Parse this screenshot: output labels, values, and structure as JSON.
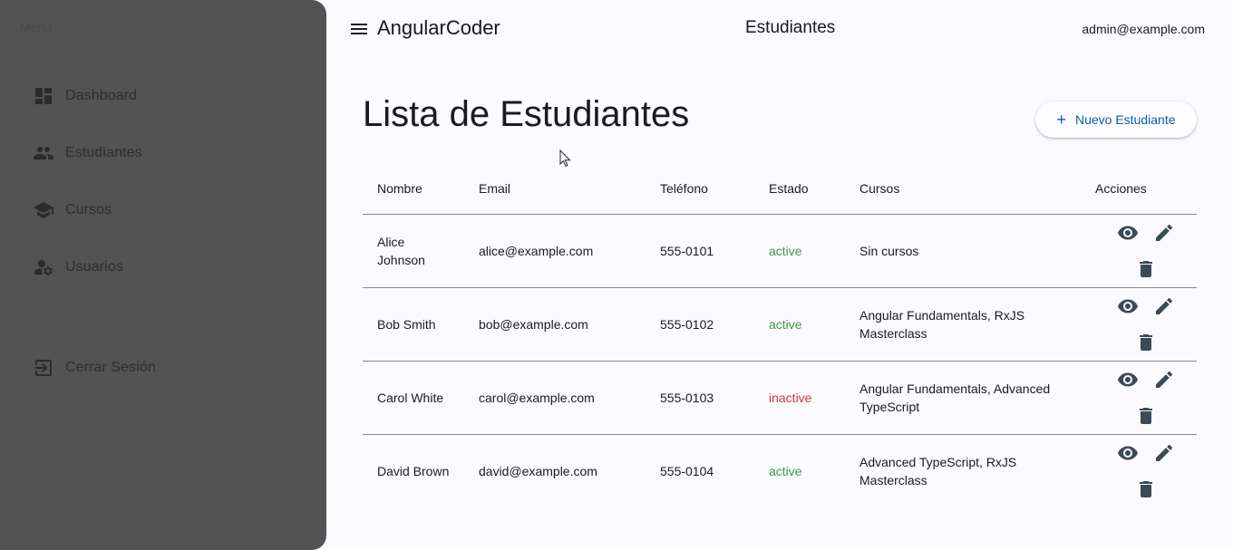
{
  "sidebar": {
    "logo": "Menu",
    "items": [
      {
        "label": "Dashboard",
        "icon": "dashboard-icon"
      },
      {
        "label": "Estudiantes",
        "icon": "people-icon"
      },
      {
        "label": "Cursos",
        "icon": "school-icon"
      },
      {
        "label": "Usuarios",
        "icon": "manage-accounts-icon"
      }
    ],
    "logout": {
      "label": "Cerrar Sesión",
      "icon": "logout-icon"
    }
  },
  "topbar": {
    "app_title": "AngularCoder",
    "page_heading": "Estudiantes",
    "user_email": "admin@example.com"
  },
  "main": {
    "title": "Lista de Estudiantes",
    "new_button": {
      "icon": "+",
      "label": "Nuevo Estudiante"
    }
  },
  "table": {
    "columns": [
      "Nombre",
      "Email",
      "Teléfono",
      "Estado",
      "Cursos",
      "Acciones"
    ],
    "rows": [
      {
        "name": "Alice Johnson",
        "email": "alice@example.com",
        "phone": "555-0101",
        "status": "active",
        "courses": "Sin cursos"
      },
      {
        "name": "Bob Smith",
        "email": "bob@example.com",
        "phone": "555-0102",
        "status": "active",
        "courses": "Angular Fundamentals, RxJS Masterclass"
      },
      {
        "name": "Carol White",
        "email": "carol@example.com",
        "phone": "555-0103",
        "status": "inactive",
        "courses": "Angular Fundamentals, Advanced TypeScript"
      },
      {
        "name": "David Brown",
        "email": "david@example.com",
        "phone": "555-0104",
        "status": "active",
        "courses": "Advanced TypeScript, RxJS Masterclass"
      }
    ],
    "action_icons": [
      "visibility-icon",
      "edit-icon",
      "delete-icon"
    ]
  },
  "colors": {
    "sidebar_bg": "#535353",
    "page_bg": "#fafaff",
    "accent": "#0b5cad",
    "status_active": "#3e9b46",
    "status_inactive": "#d33a2c"
  }
}
